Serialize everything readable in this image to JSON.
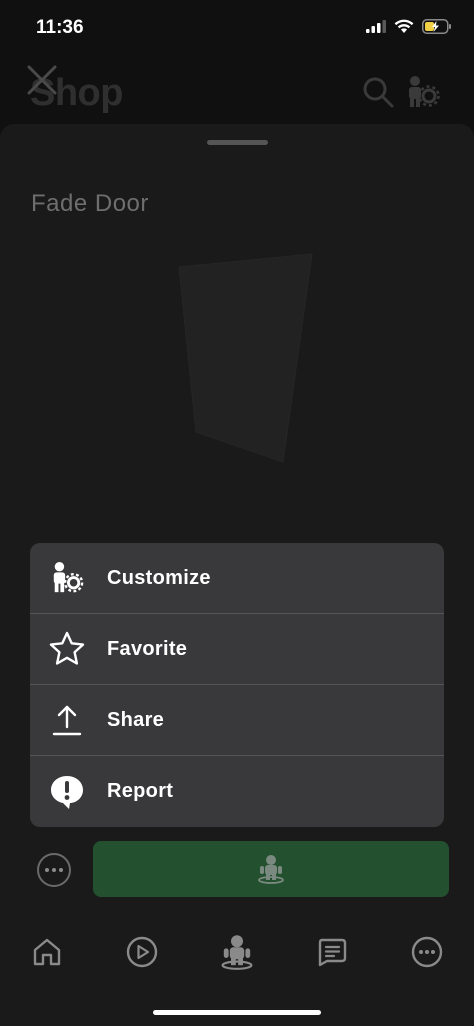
{
  "status_bar": {
    "time": "11:36"
  },
  "header": {
    "title": "Shop"
  },
  "item": {
    "name": "Fade Door"
  },
  "action_menu": {
    "items": [
      {
        "label": "Customize",
        "icon": "avatar-gear-icon"
      },
      {
        "label": "Favorite",
        "icon": "star-icon"
      },
      {
        "label": "Share",
        "icon": "share-icon"
      },
      {
        "label": "Report",
        "icon": "report-icon"
      }
    ]
  },
  "tabs": [
    {
      "name": "home",
      "icon": "home-icon"
    },
    {
      "name": "discover",
      "icon": "play-icon"
    },
    {
      "name": "avatar",
      "icon": "avatar-icon"
    },
    {
      "name": "chat",
      "icon": "chat-icon"
    },
    {
      "name": "more",
      "icon": "more-icon"
    }
  ],
  "colors": {
    "menu_background": "#39393b",
    "try_on_button": "#23502f",
    "sheet_background": "#1a1a1a"
  }
}
